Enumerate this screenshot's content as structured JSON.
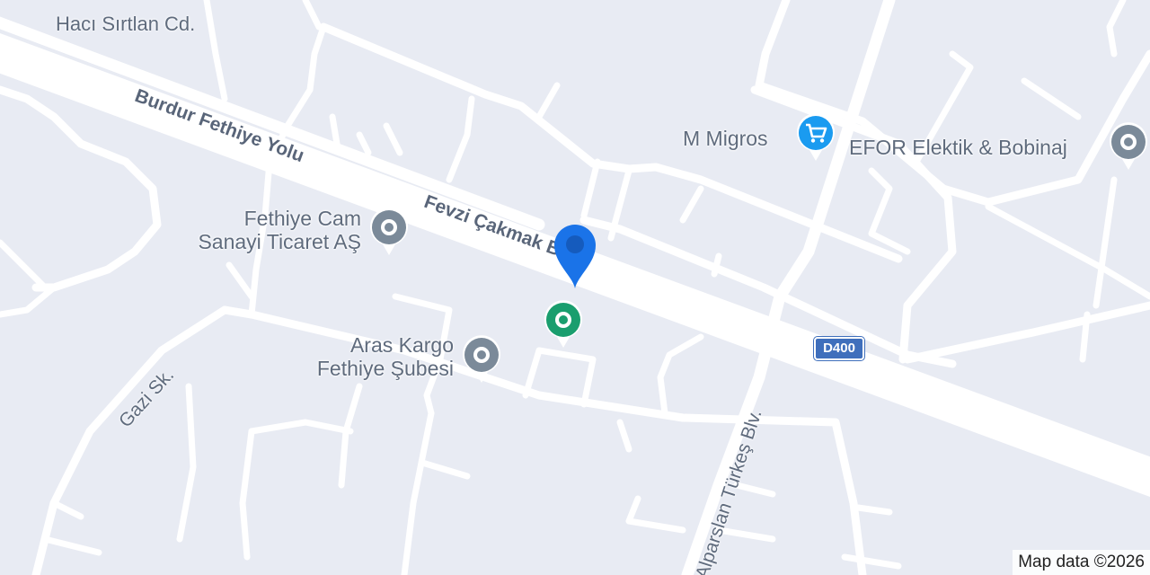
{
  "map": {
    "streets": {
      "haci_sirtlan": "Hacı Sırtlan Cd.",
      "burdur_fethiye": "Burdur Fethiye Yolu",
      "fevzi_cakmak": "Fevzi Çakmak Blv.",
      "gazi": "Gazi Sk.",
      "alparslan_turkes": "Alparslan Türkeş Blv."
    },
    "highway_shield": "D400",
    "places": {
      "migros": {
        "label": "M Migros",
        "icon": "shopping-cart-icon",
        "color": "#1a9bf0"
      },
      "efor": {
        "label": "EFOR Elektik & Bobinaj",
        "icon": "place-dot-icon",
        "color": "#7b8a99"
      },
      "fethiye_cam": {
        "line1": "Fethiye Cam",
        "line2": "Sanayi Ticaret AŞ",
        "icon": "place-dot-icon",
        "color": "#7b8a99"
      },
      "aras_kargo": {
        "line1": "Aras Kargo",
        "line2": "Fethiye Şubesi",
        "icon": "place-dot-icon",
        "color": "#7b8a99"
      },
      "green_place": {
        "icon": "place-dot-icon",
        "color": "#1a9e6e"
      }
    },
    "location_pin": {
      "icon": "location-pin-icon",
      "color": "#1a73e8"
    },
    "attribution": "Map data ©2026"
  }
}
